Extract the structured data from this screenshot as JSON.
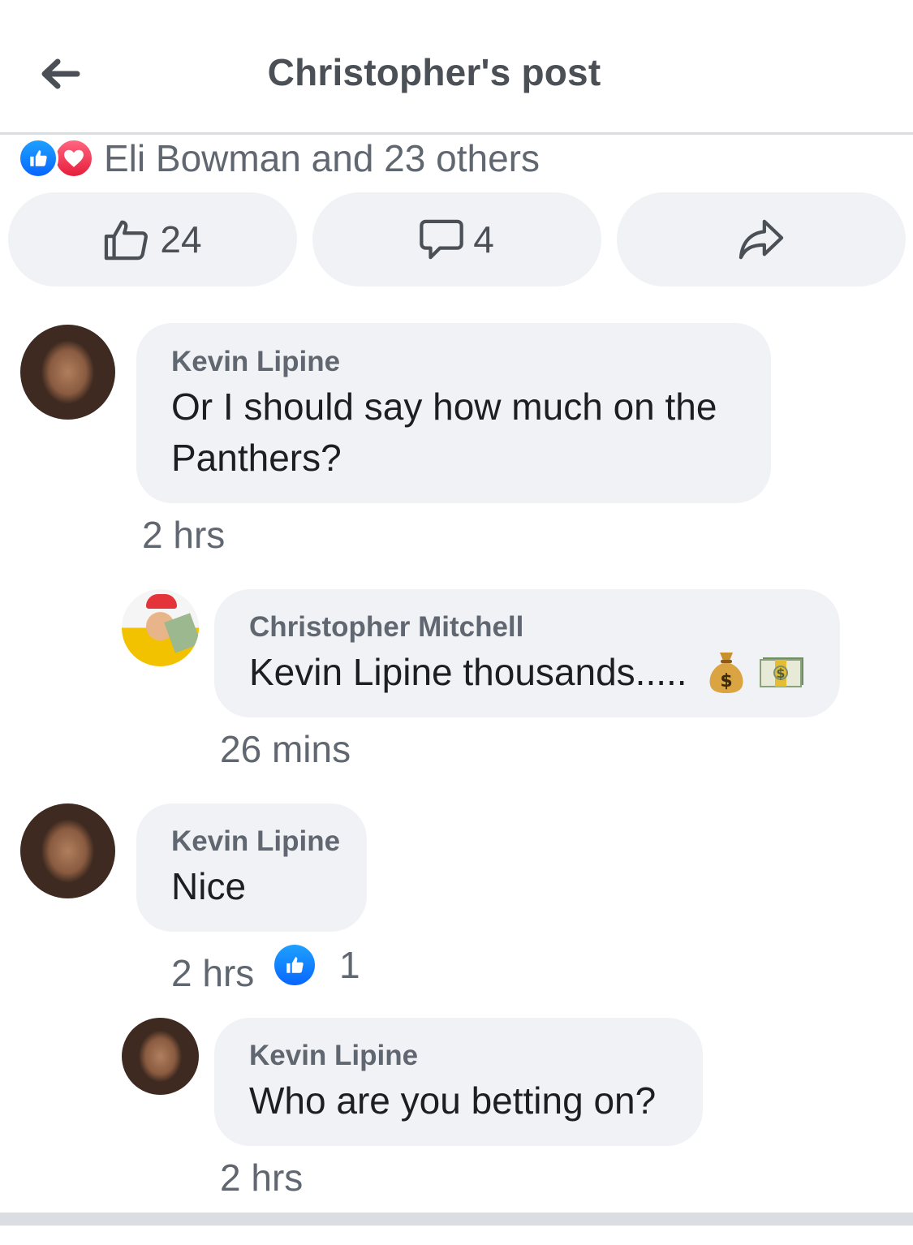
{
  "header": {
    "title": "Christopher's post",
    "back_icon": "arrow-left-icon"
  },
  "reactions": {
    "icons": [
      "like-reaction-icon",
      "love-reaction-icon"
    ],
    "summary": "Eli Bowman and 23 others"
  },
  "actions": {
    "like_count": "24",
    "comment_count": "4",
    "share_icon": "share-arrow-icon"
  },
  "comments": [
    {
      "author": "Kevin Lipine",
      "line1": "Or I should say how much on the",
      "line2": "Panthers?",
      "time": "2 hrs"
    },
    {
      "author": "Christopher Mitchell",
      "text": "Kevin Lipine thousands.....",
      "emojis": [
        "money-bag-icon",
        "dollar-banknote-icon"
      ],
      "time": "26 mins"
    },
    {
      "author": "Kevin Lipine",
      "text": "Nice",
      "time": "2 hrs",
      "like_count": "1"
    },
    {
      "author": "Kevin Lipine",
      "text": "Who are you betting on?",
      "time": "2 hrs"
    }
  ],
  "colors": {
    "accent": "#0866ff",
    "love": "#e61e3c",
    "bubble": "#f0f2f5",
    "meta_text": "#606770"
  }
}
